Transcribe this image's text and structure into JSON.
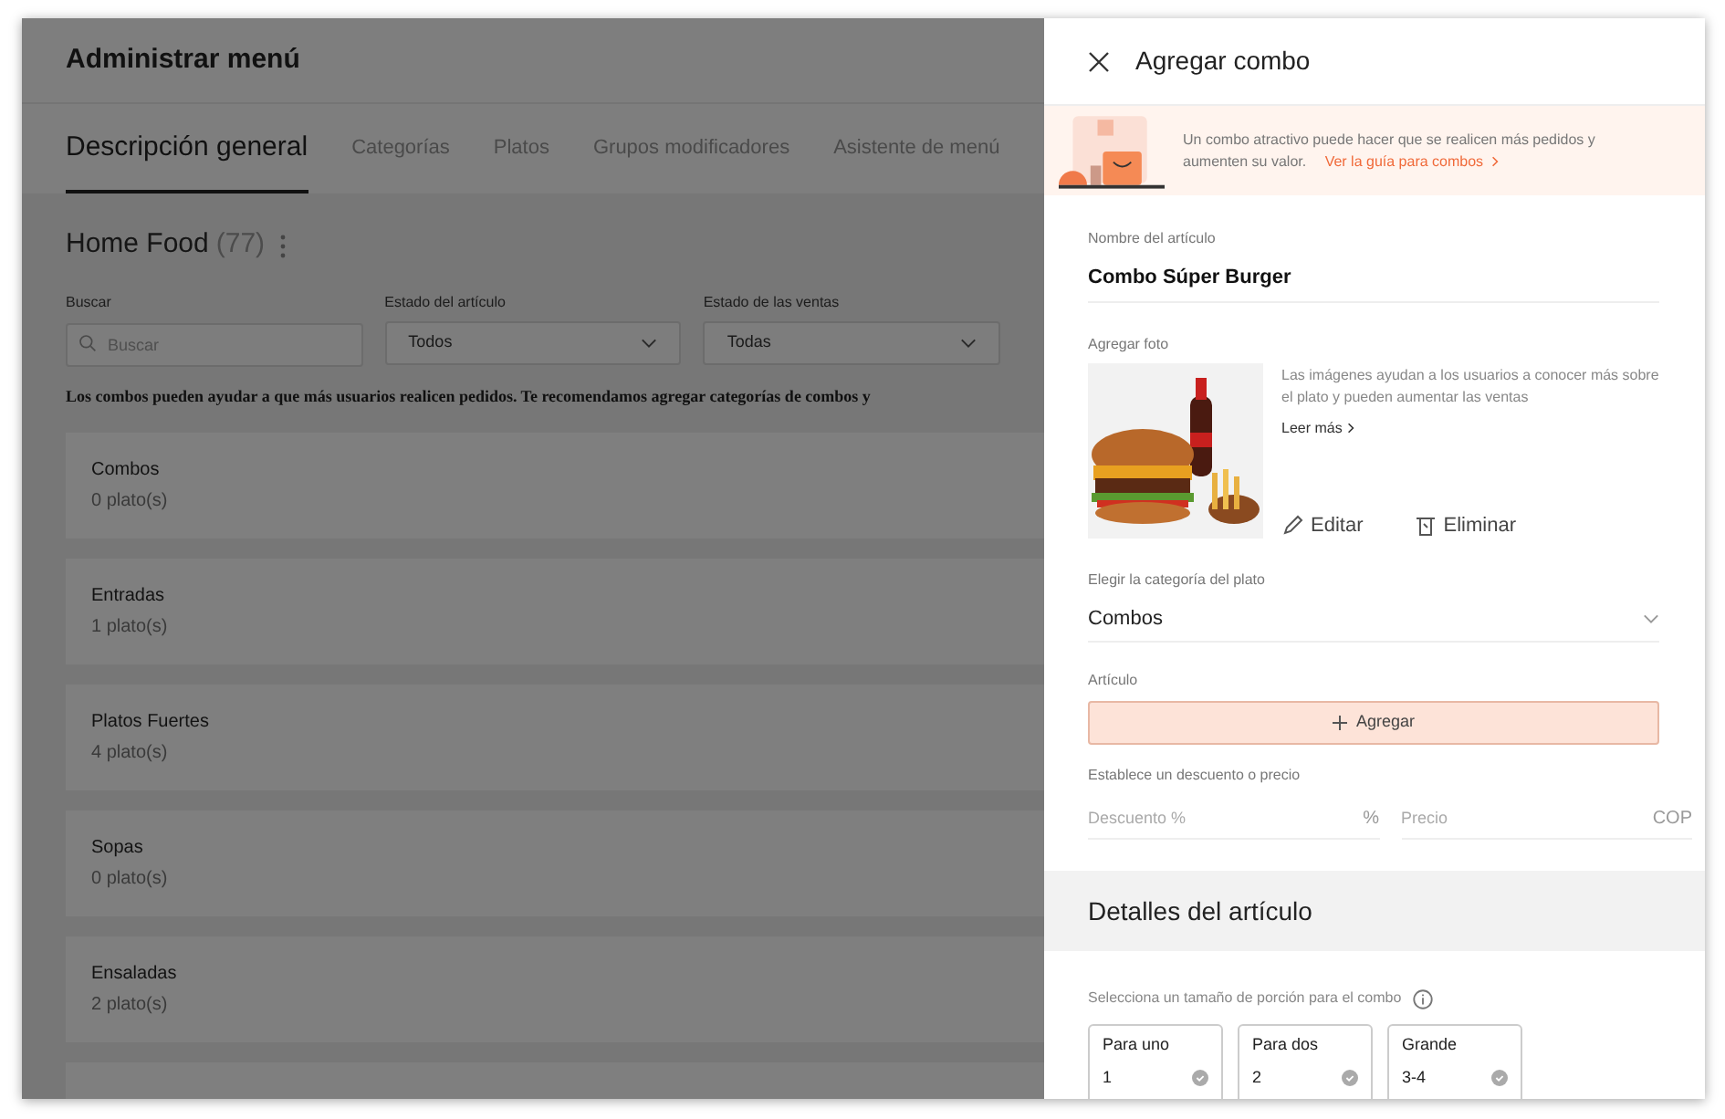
{
  "page": {
    "title": "Administrar menú",
    "tabs": [
      {
        "label": "Descripción general",
        "selected": true
      },
      {
        "label": "Categorías",
        "selected": false
      },
      {
        "label": "Platos",
        "selected": false
      },
      {
        "label": "Grupos modificadores",
        "selected": false
      },
      {
        "label": "Asistente de menú",
        "selected": false
      }
    ],
    "store": {
      "name": "Home Food",
      "count": "(77)"
    },
    "filters": [
      {
        "kind": "search",
        "label": "Buscar",
        "placeholder": "Buscar"
      },
      {
        "kind": "select",
        "label": "Estado del artículo",
        "value": "Todos"
      },
      {
        "kind": "select",
        "label": "Estado de las ventas",
        "value": "Todas"
      }
    ],
    "notice": "Los combos pueden ayudar a que más usuarios realicen pedidos. Te recomendamos agregar categorías de combos y",
    "categories": [
      {
        "name": "Combos",
        "count": "0 plato(s)"
      },
      {
        "name": "Entradas",
        "count": "1 plato(s)"
      },
      {
        "name": "Platos Fuertes",
        "count": "4 plato(s)"
      },
      {
        "name": "Sopas",
        "count": "0 plato(s)"
      },
      {
        "name": "Ensaladas",
        "count": "2 plato(s)"
      }
    ]
  },
  "drawer": {
    "title": "Agregar combo",
    "banner": {
      "text": "Un combo atractivo puede hacer que se realicen más pedidos y aumenten su valor.",
      "link": "Ver la guía para combos"
    },
    "name_field": {
      "label": "Nombre del artículo",
      "value": "Combo Súper Burger"
    },
    "photo": {
      "label": "Agregar foto",
      "hint": "Las imágenes ayudan a los usuarios a conocer más sobre el plato y pueden aumentar las ventas",
      "more": "Leer más",
      "edit": "Editar",
      "delete": "Eliminar"
    },
    "category_field": {
      "label": "Elegir la categoría del plato",
      "value": "Combos"
    },
    "item": {
      "label": "Artículo",
      "button": "Agregar"
    },
    "pricing": {
      "label": "Establece un descuento o precio",
      "discount": {
        "placeholder": "Descuento %",
        "suffix": "%"
      },
      "price": {
        "placeholder": "Precio",
        "suffix": "COP"
      }
    },
    "details": {
      "title": "Detalles del artículo",
      "portion_label": "Selecciona un tamaño de porción para el combo",
      "portions": [
        {
          "name": "Para uno",
          "count": "1",
          "selected": false
        },
        {
          "name": "Para dos",
          "count": "2",
          "selected": false
        },
        {
          "name": "Grande",
          "count": "3-4",
          "selected": false
        }
      ]
    }
  }
}
